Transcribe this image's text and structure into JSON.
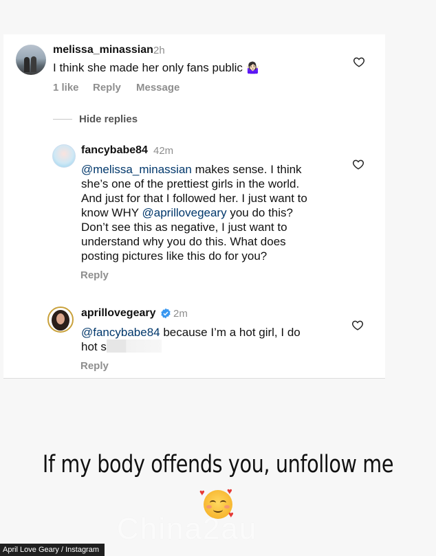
{
  "comments": [
    {
      "username": "melissa_minassian",
      "time": "2h",
      "text": "I think she made her only fans public",
      "emoji": "🤷🏻‍♀️",
      "likes": "1 like",
      "reply": "Reply",
      "message": "Message"
    }
  ],
  "hide_replies": "Hide replies",
  "replies": [
    {
      "username": "fancybabe84",
      "time": "42m",
      "mention1": "@melissa_minassian",
      "line1_rest": " makes sense. I think",
      "line2": "she’s one of the prettiest girls in the world.",
      "line3": "And just for that I followed her. I just want to",
      "line4_pre": "know WHY ",
      "mention2": "@aprillovegeary",
      "line4_rest": " you do this?",
      "line5": "Don’t see this as negative, I just want to",
      "line6": "understand why you do this. What does",
      "line7": "posting pictures like this do for you?",
      "reply": "Reply"
    },
    {
      "username": "aprillovegeary",
      "time": "2m",
      "mention": "@fancybabe84",
      "line1_rest": " because I’m a hot girl, I do",
      "line2": "hot s",
      "reply": "Reply"
    }
  ],
  "caption": "If my body offends you, unfollow me",
  "emoji": "🥰",
  "watermark": "China2au",
  "credit": "April Love Geary / Instagram",
  "colors": {
    "mention": "#00376b",
    "meta": "#8e8e8e",
    "verified": "#3897f0"
  },
  "icons": [
    "heart-icon",
    "verified-badge-icon"
  ]
}
